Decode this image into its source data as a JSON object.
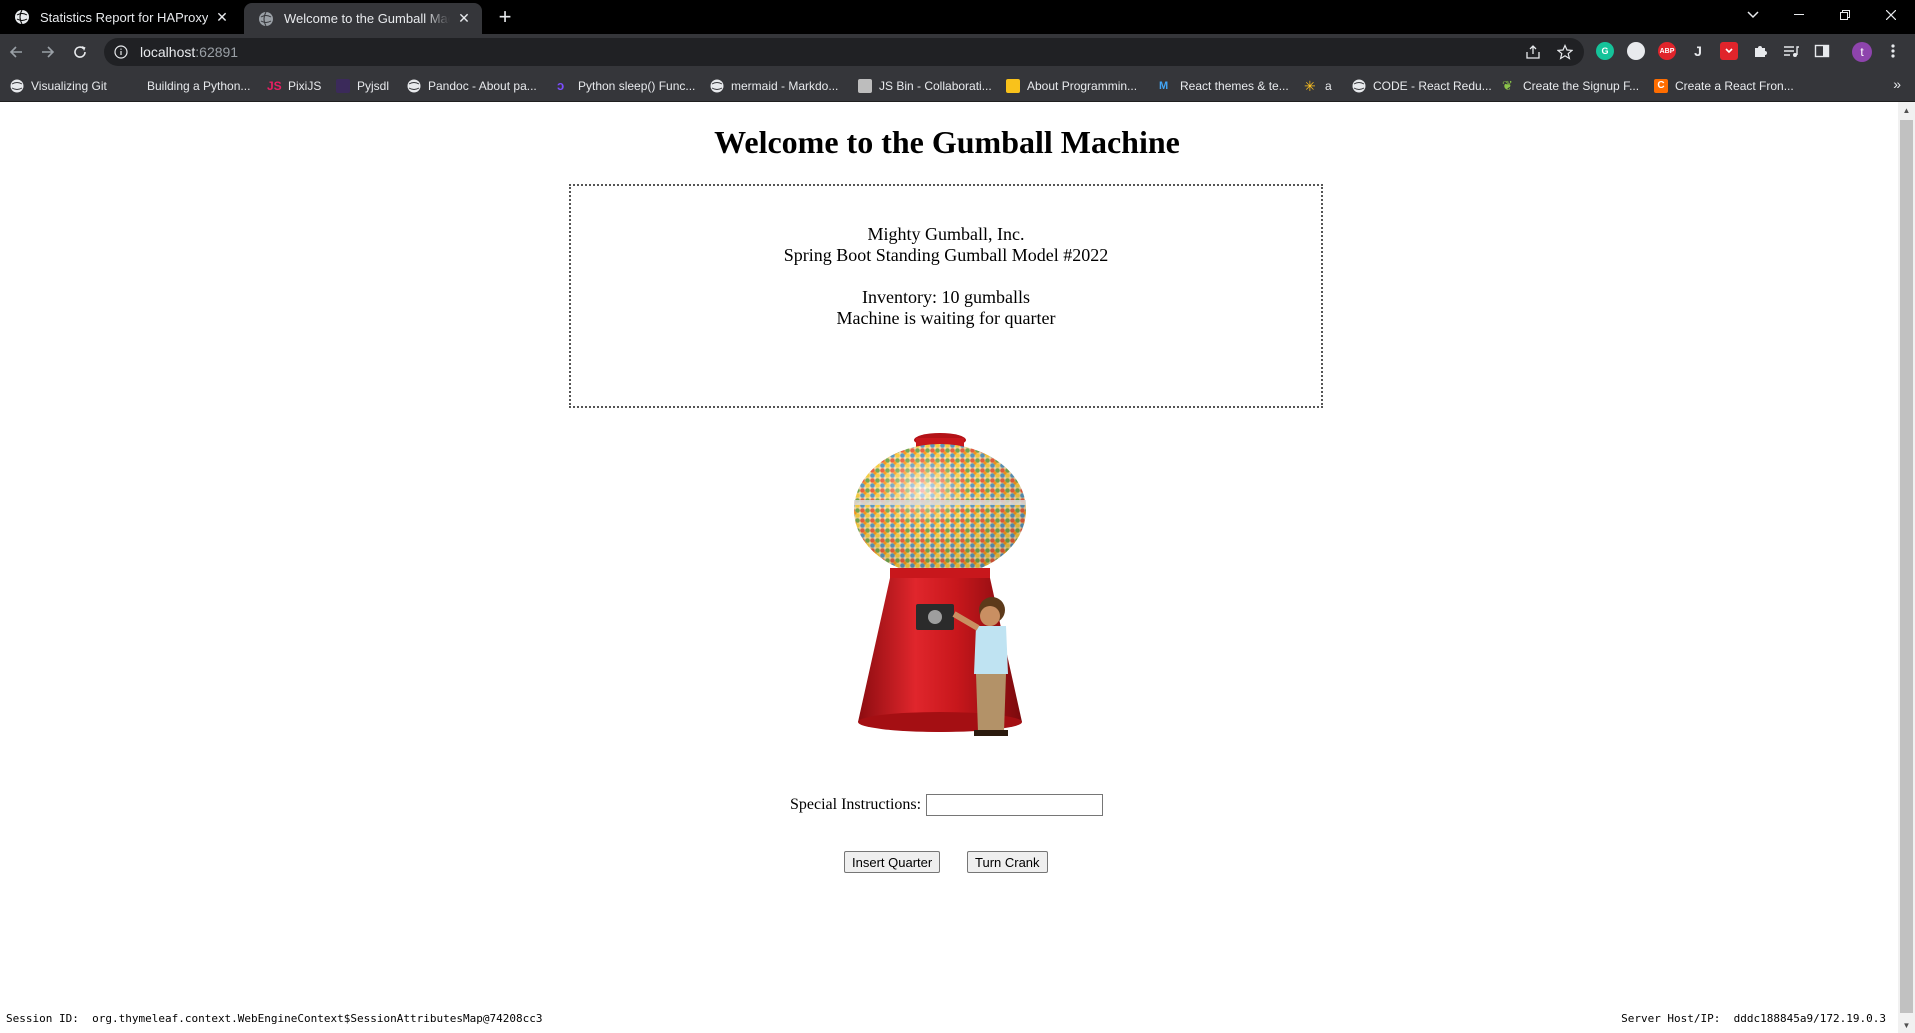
{
  "browser": {
    "tabs": [
      {
        "title": "Statistics Report for HAProxy",
        "active": false
      },
      {
        "title": "Welcome to the Gumball Machine",
        "active": true
      }
    ],
    "url_host": "localhost",
    "url_port": ":62891",
    "profile_initial": "t",
    "extensions": {
      "abp": "ABP",
      "j": "J"
    }
  },
  "bookmarks": [
    {
      "label": "Visualizing Git",
      "icon": "globe-icon"
    },
    {
      "label": "Building a Python...",
      "icon": "python-icon"
    },
    {
      "label": "PixiJS",
      "icon": "pixijs-icon"
    },
    {
      "label": "Pyjsdl",
      "icon": "pyjsdl-icon"
    },
    {
      "label": "Pandoc - About pa...",
      "icon": "globe-icon"
    },
    {
      "label": "Python sleep() Func...",
      "icon": "python-icon"
    },
    {
      "label": "mermaid - Markdo...",
      "icon": "globe-icon"
    },
    {
      "label": "JS Bin - Collaborati...",
      "icon": "jsbin-icon"
    },
    {
      "label": "About Programmin...",
      "icon": "folder-icon"
    },
    {
      "label": "React themes & te...",
      "icon": "react-icon"
    },
    {
      "label": "a",
      "icon": "walmart-icon"
    },
    {
      "label": "CODE - React Redu...",
      "icon": "globe-icon"
    },
    {
      "label": "Create the Signup F...",
      "icon": "leaf-icon"
    },
    {
      "label": "Create a React Fron...",
      "icon": "codecademy-icon"
    }
  ],
  "page": {
    "heading": "Welcome to the Gumball Machine",
    "company": "Mighty Gumball, Inc.",
    "model": "Spring Boot Standing Gumball Model #2022",
    "inventory": "Inventory: 10 gumballs",
    "state": "Machine is waiting for quarter",
    "instructions_label": "Special Instructions:",
    "instructions_value": "",
    "insert_quarter_label": "Insert Quarter",
    "turn_crank_label": "Turn Crank",
    "session_label": "Session ID:",
    "session_value": "org.thymeleaf.context.WebEngineContext$SessionAttributesMap@74208cc3",
    "server_label": "Server Host/IP:",
    "server_value": "dddc188845a9/172.19.0.3"
  },
  "colors": {
    "gumball_red": "#c8171c",
    "tabstrip_bg": "#000000",
    "toolbar_bg": "#35363a"
  }
}
